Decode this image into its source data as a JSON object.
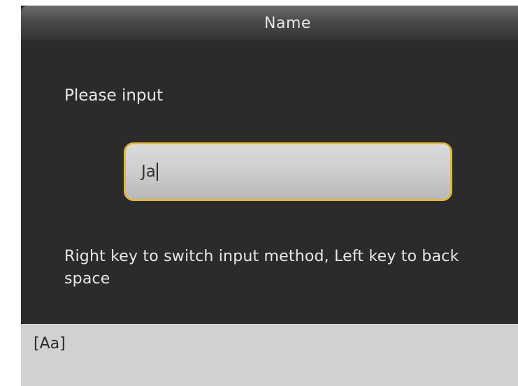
{
  "header": {
    "title": "Name"
  },
  "form": {
    "prompt": "Please input",
    "input_value": "Ja",
    "hint": "Right key to switch input method, Left key to back space"
  },
  "ime": {
    "mode_label": "[Aa]"
  },
  "colors": {
    "screen_bg": "#2b2b2b",
    "input_border": "#e0b640",
    "input_bg": "#cfcfcf",
    "ime_bar_bg": "#d2d0d1",
    "text_light": "#e8e8e8"
  }
}
